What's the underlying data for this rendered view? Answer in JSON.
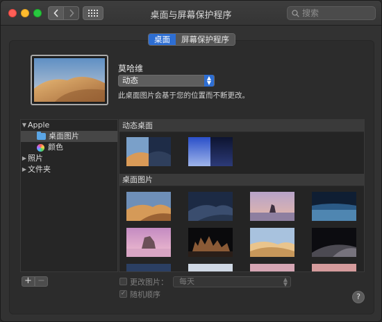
{
  "window": {
    "title": "桌面与屏幕保护程序",
    "search_placeholder": "搜索",
    "nav_back_icon": "chevron-left-icon",
    "nav_forward_icon": "chevron-right-icon",
    "show_all_icon": "grid-icon"
  },
  "tabs": [
    {
      "label": "桌面",
      "active": true
    },
    {
      "label": "屏幕保护程序",
      "active": false
    }
  ],
  "current": {
    "name": "莫哈维",
    "mode": "动态",
    "description": "此桌面图片会基于您的位置而不断更改。"
  },
  "sidebar": {
    "group": "Apple",
    "items": [
      {
        "label": "桌面图片",
        "icon": "folder-icon",
        "selected": true
      },
      {
        "label": "颜色",
        "icon": "color-wheel-icon",
        "selected": false
      }
    ],
    "other_groups": [
      "照片",
      "文件夹"
    ]
  },
  "sections": {
    "dynamic": "动态桌面",
    "pictures": "桌面图片"
  },
  "bottom": {
    "add_label": "+",
    "remove_label": "−",
    "change_picture_label": "更改图片：",
    "change_picture_checked": false,
    "interval": "每天",
    "random_order_label": "随机顺序",
    "random_order_checked": true,
    "help_label": "?"
  },
  "colors": {
    "accent": "#2d6ed3",
    "window_bg": "#323232"
  }
}
